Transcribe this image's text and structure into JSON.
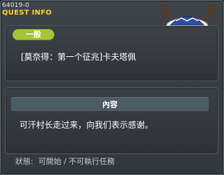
{
  "window": {
    "quest_id": "64019-0",
    "title": "QUEST INFO"
  },
  "quest": {
    "category": "一般",
    "name": "[莫奈得：第一个征兆]卡夫塔佩"
  },
  "content": {
    "header": "內容",
    "text": "可汗村长走过来，向我们表示感谢。"
  },
  "status": {
    "label": "狀態:",
    "value": "可開始 / 不可執行任務"
  },
  "colors": {
    "title": "#ffd322",
    "badge": "#a7c43a",
    "content_header": "#4c5a64"
  },
  "npc": {
    "icon": "antlered-npc-portrait"
  }
}
